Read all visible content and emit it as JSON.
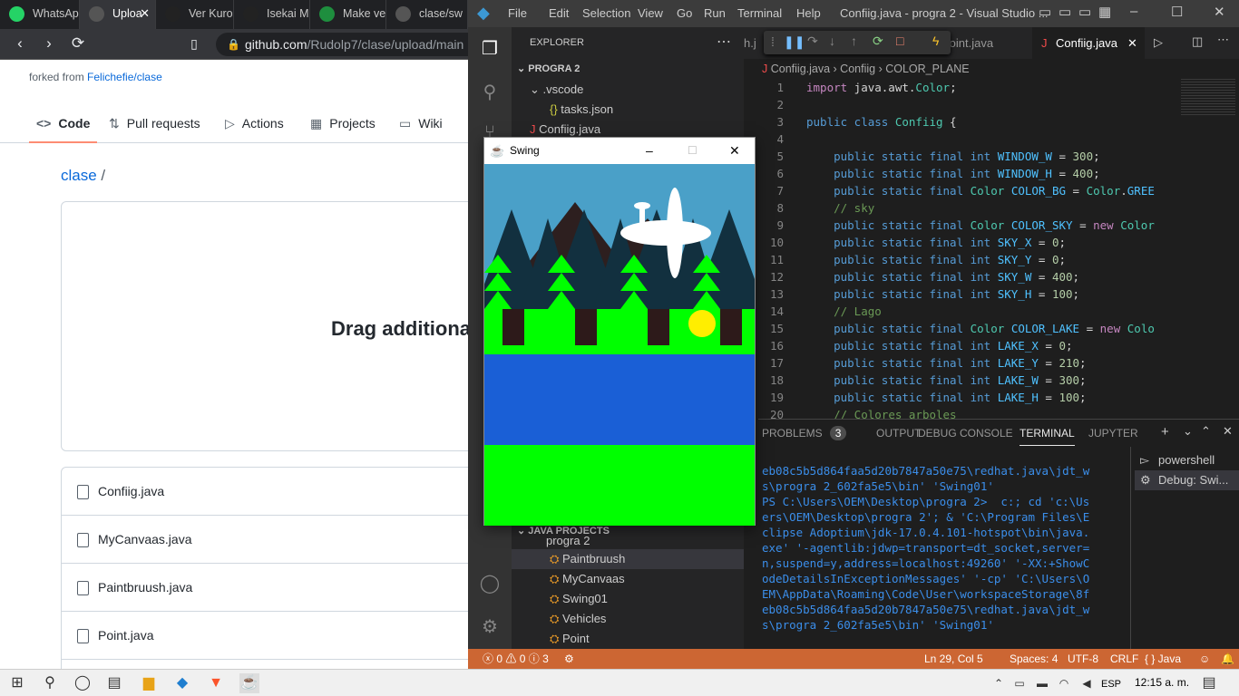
{
  "browser": {
    "tabs": [
      {
        "title": "WhatsAp",
        "icon": "whatsapp-icon",
        "color": "#25d366"
      },
      {
        "title": "Uploa",
        "icon": "github-icon",
        "color": "#555555",
        "active": true
      },
      {
        "title": "Ver Kuro",
        "icon": "af-icon",
        "color": "#222222"
      },
      {
        "title": "Isekai M",
        "icon": "af-icon",
        "color": "#222222"
      },
      {
        "title": "Make ve",
        "icon": "classroom-icon",
        "color": "#1e8e3e"
      },
      {
        "title": "clase/sw",
        "icon": "github-icon",
        "color": "#555555"
      }
    ],
    "url_host": "github.com",
    "url_path": "/Rudolp7/clase/upload/main",
    "page": {
      "forked_prefix": "forked from ",
      "forked_link": "Felichefie/clase",
      "nav": [
        "Code",
        "Pull requests",
        "Actions",
        "Projects",
        "Wiki"
      ],
      "breadcrumb_repo": "clase",
      "breadcrumb_sep": "/",
      "drag_text": "Drag additiona",
      "files": [
        "Confiig.java",
        "MyCanvaas.java",
        "Paintbruush.java",
        "Point.java"
      ]
    }
  },
  "vscode": {
    "menu": [
      "File",
      "Edit",
      "Selection",
      "View",
      "Go",
      "Run",
      "Terminal",
      "Help"
    ],
    "window_title": "Confiig.java - progra 2 - Visual Studio ...",
    "explorer": {
      "header": "EXPLORER",
      "root": "PROGRA 2",
      "items": [
        ".vscode",
        "tasks.json",
        "Confiig.java"
      ],
      "java_projects_header": "JAVA PROJECTS",
      "java_project": "progra 2",
      "classes": [
        "Paintbruush",
        "MyCanvaas",
        "Swing01",
        "Vehicles",
        "Point"
      ]
    },
    "editor_tabs": [
      "h.j",
      "Point.java",
      "Confiig.java"
    ],
    "breadcrumb": [
      "Confiig.java",
      "Confiig",
      "COLOR_PLANE"
    ],
    "code_lines": [
      {
        "n": "1",
        "html": "<span class='kw2'>import</span> java.awt.<span class='ty'>Color</span>;"
      },
      {
        "n": "2",
        "html": ""
      },
      {
        "n": "3",
        "html": "<span class='kw'>public class</span> <span class='ty'>Confiig</span> {"
      },
      {
        "n": "4",
        "html": ""
      },
      {
        "n": "5",
        "html": "    <span class='kw'>public static final int</span> <span class='cn'>WINDOW_W</span> = <span class='nm'>300</span>;"
      },
      {
        "n": "6",
        "html": "    <span class='kw'>public static final int</span> <span class='cn'>WINDOW_H</span> = <span class='nm'>400</span>;"
      },
      {
        "n": "7",
        "html": "    <span class='kw'>public static final</span> <span class='ty'>Color</span> <span class='cn'>COLOR_BG</span> = <span class='ty'>Color</span>.<span class='cn'>GREE</span>"
      },
      {
        "n": "8",
        "html": "    <span class='cm'>// sky</span>"
      },
      {
        "n": "9",
        "html": "    <span class='kw'>public static final</span> <span class='ty'>Color</span> <span class='cn'>COLOR_SKY</span> = <span class='kw2'>new</span> <span class='ty'>Color</span>"
      },
      {
        "n": "10",
        "html": "    <span class='kw'>public static final int</span> <span class='cn'>SKY_X</span> = <span class='nm'>0</span>;"
      },
      {
        "n": "11",
        "html": "    <span class='kw'>public static final int</span> <span class='cn'>SKY_Y</span> = <span class='nm'>0</span>;"
      },
      {
        "n": "12",
        "html": "    <span class='kw'>public static final int</span> <span class='cn'>SKY_W</span> = <span class='nm'>400</span>;"
      },
      {
        "n": "13",
        "html": "    <span class='kw'>public static final int</span> <span class='cn'>SKY_H</span> = <span class='nm'>100</span>;"
      },
      {
        "n": "14",
        "html": "    <span class='cm'>// Lago</span>"
      },
      {
        "n": "15",
        "html": "    <span class='kw'>public static final</span> <span class='ty'>Color</span> <span class='cn'>COLOR_LAKE</span> = <span class='kw2'>new</span> <span class='ty'>Colo</span>"
      },
      {
        "n": "16",
        "html": "    <span class='kw'>public static final int</span> <span class='cn'>LAKE_X</span> = <span class='nm'>0</span>;"
      },
      {
        "n": "17",
        "html": "    <span class='kw'>public static final int</span> <span class='cn'>LAKE_Y</span> = <span class='nm'>210</span>;"
      },
      {
        "n": "18",
        "html": "    <span class='kw'>public static final int</span> <span class='cn'>LAKE_W</span> = <span class='nm'>300</span>;"
      },
      {
        "n": "19",
        "html": "    <span class='kw'>public static final int</span> <span class='cn'>LAKE_H</span> = <span class='nm'>100</span>;"
      },
      {
        "n": "20",
        "html": "    <span class='cm'>// Colores arboles</span>"
      }
    ],
    "panel_tabs": [
      "PROBLEMS",
      "OUTPUT",
      "DEBUG CONSOLE",
      "TERMINAL",
      "JUPYTER"
    ],
    "problems_count": "3",
    "terminal_text": "eb08c5b5d864faa5d20b7847a50e75\\redhat.java\\jdt_w\ns\\progra 2_602fa5e5\\bin' 'Swing01'\nPS C:\\Users\\OEM\\Desktop\\progra 2>  c:; cd 'c:\\Us\ners\\OEM\\Desktop\\progra 2'; & 'C:\\Program Files\\E\nclipse Adoptium\\jdk-17.0.4.101-hotspot\\bin\\java.\nexe' '-agentlib:jdwp=transport=dt_socket,server=\nn,suspend=y,address=localhost:49260' '-XX:+ShowC\nodeDetailsInExceptionMessages' '-cp' 'C:\\Users\\O\nEM\\AppData\\Roaming\\Code\\User\\workspaceStorage\\8f\neb08c5b5d864faa5d20b7847a50e75\\redhat.java\\jdt_w\ns\\progra 2_602fa5e5\\bin' 'Swing01'",
    "terminals": [
      "powershell",
      "Debug: Swi..."
    ],
    "status": {
      "errors": "0",
      "warnings": "0",
      "info": "3",
      "position": "Ln 29, Col 5",
      "spaces": "Spaces: 4",
      "encoding": "UTF-8",
      "eol": "CRLF",
      "language": "{ } Java"
    },
    "status_color": "#cc6633"
  },
  "swing": {
    "title": "Swing",
    "sky_color": "#4aa0c8",
    "grass_color": "#00ff00",
    "lake_color": "#1a5fd6",
    "tree_color": "#12303f",
    "trunk_color": "#2d1a1a",
    "mountain_color": "#2d1f1f",
    "sun_color": "#ffee00"
  },
  "taskbar": {
    "lang": "ESP",
    "clock": "12:15 a. m."
  }
}
